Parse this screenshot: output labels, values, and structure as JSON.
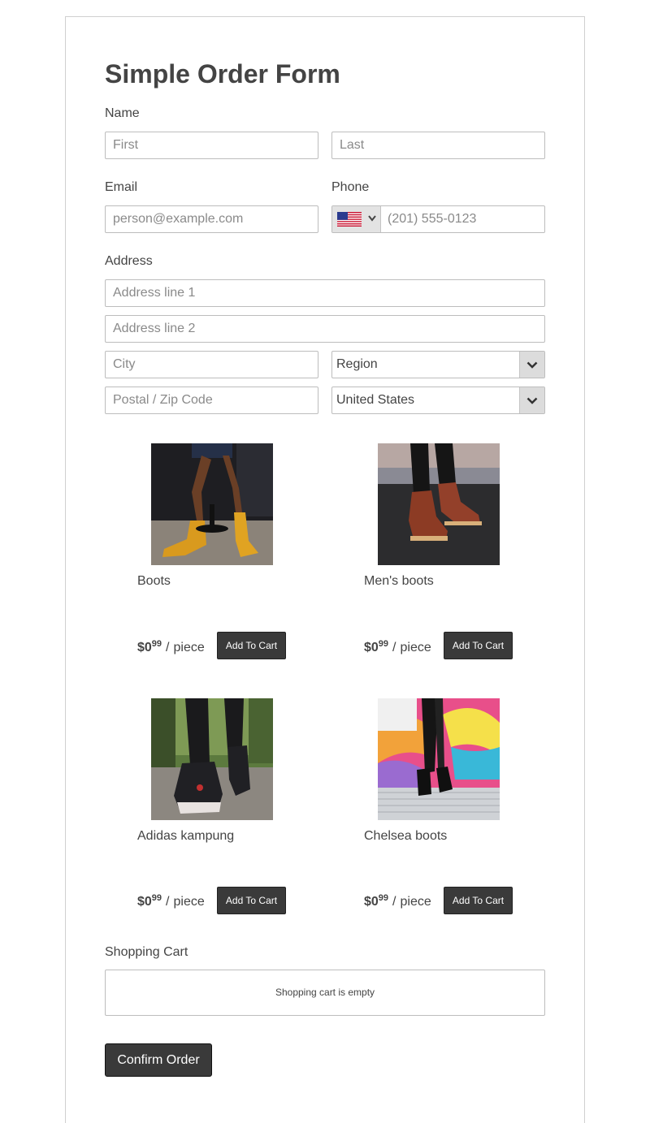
{
  "form": {
    "title": "Simple Order Form",
    "name_label": "Name",
    "first_placeholder": "First",
    "last_placeholder": "Last",
    "email_label": "Email",
    "email_placeholder": "person@example.com",
    "phone_label": "Phone",
    "phone_placeholder": "(201) 555-0123",
    "phone_country_icon": "us-flag-icon",
    "address_label": "Address",
    "address1_placeholder": "Address line 1",
    "address2_placeholder": "Address line 2",
    "city_placeholder": "City",
    "region_value": "Region",
    "postal_placeholder": "Postal / Zip Code",
    "country_value": "United States"
  },
  "products": [
    {
      "name": "Boots",
      "price_dollars": "$0",
      "price_cents": "99",
      "unit": "piece",
      "button": "Add To Cart",
      "image": "yellow-ankle-boots-photo"
    },
    {
      "name": "Men's boots",
      "price_dollars": "$0",
      "price_cents": "99",
      "unit": "piece",
      "button": "Add To Cart",
      "image": "brown-mens-boots-photo"
    },
    {
      "name": "Adidas kampung",
      "price_dollars": "$0",
      "price_cents": "99",
      "unit": "piece",
      "button": "Add To Cart",
      "image": "black-sneakers-photo"
    },
    {
      "name": "Chelsea boots",
      "price_dollars": "$0",
      "price_cents": "99",
      "unit": "piece",
      "button": "Add To Cart",
      "image": "black-heeled-boots-graffiti-photo"
    }
  ],
  "cart": {
    "label": "Shopping Cart",
    "empty_text": "Shopping cart is empty"
  },
  "confirm_label": "Confirm Order",
  "colors": {
    "button_bg": "#3a3a3a",
    "border": "#bdbdbd",
    "text": "#444444"
  }
}
